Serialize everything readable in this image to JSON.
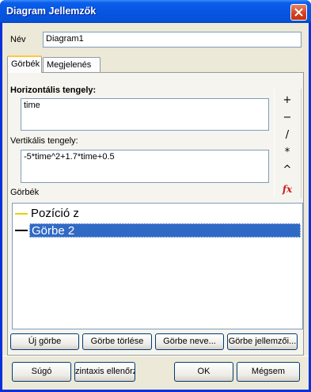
{
  "window": {
    "title": "Diagram Jellemzők"
  },
  "name_field": {
    "label": "Név",
    "value": "Diagram1"
  },
  "tabs": [
    {
      "label": "Görbék",
      "active": true
    },
    {
      "label": "Megjelenés",
      "active": false
    }
  ],
  "horizontal_axis": {
    "label": "Horizontális tengely:",
    "value": "time"
  },
  "vertical_axis": {
    "label": "Vertikális tengely:",
    "value": "-5*time^2+1.7*time+0.5"
  },
  "operator_buttons": [
    "+",
    "−",
    "/",
    "*",
    "^"
  ],
  "function_button": "fx",
  "curves_section": {
    "label": "Görbék"
  },
  "curves": [
    {
      "name": "Pozíció z",
      "color": "#e8d200",
      "selected": false
    },
    {
      "name": "Görbe 2",
      "color": "#000000",
      "selected": true
    }
  ],
  "curve_buttons": {
    "new": "Új görbe",
    "delete": "Görbe törlése",
    "rename": "Görbe neve...",
    "properties": "Görbe jellemzői..."
  },
  "footer_buttons": {
    "help": "Súgó",
    "syntax": "zintaxis ellenőrzé",
    "ok": "OK",
    "cancel": "Mégsem"
  },
  "colors": {
    "titlebar": "#0a5fe9",
    "selection": "#316ac5",
    "fx": "#d11a1a"
  }
}
